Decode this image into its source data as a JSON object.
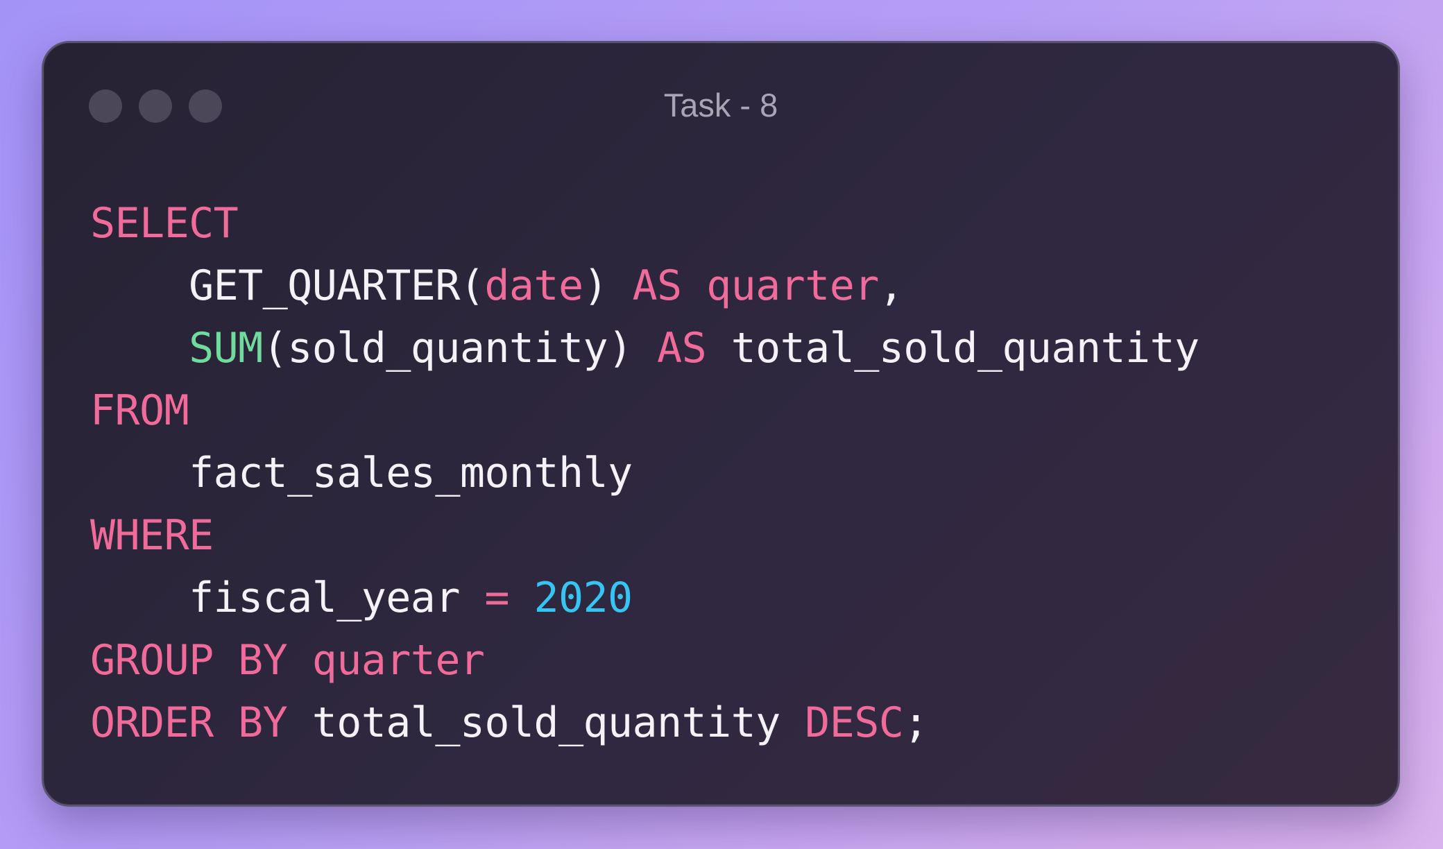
{
  "window": {
    "title": "Task - 8"
  },
  "code": {
    "lines": [
      [
        {
          "text": "SELECT",
          "kind": "keyword"
        }
      ],
      [
        {
          "text": "    GET_QUARTER(",
          "kind": "plain"
        },
        {
          "text": "date",
          "kind": "keyword"
        },
        {
          "text": ") ",
          "kind": "plain"
        },
        {
          "text": "AS",
          "kind": "keyword"
        },
        {
          "text": " ",
          "kind": "plain"
        },
        {
          "text": "quarter",
          "kind": "keyword"
        },
        {
          "text": ",",
          "kind": "plain"
        }
      ],
      [
        {
          "text": "    ",
          "kind": "plain"
        },
        {
          "text": "SUM",
          "kind": "function"
        },
        {
          "text": "(sold_quantity) ",
          "kind": "plain"
        },
        {
          "text": "AS",
          "kind": "keyword"
        },
        {
          "text": " total_sold_quantity",
          "kind": "plain"
        }
      ],
      [
        {
          "text": "FROM",
          "kind": "keyword"
        }
      ],
      [
        {
          "text": "    fact_sales_monthly",
          "kind": "plain"
        }
      ],
      [
        {
          "text": "WHERE",
          "kind": "keyword"
        }
      ],
      [
        {
          "text": "    fiscal_year ",
          "kind": "plain"
        },
        {
          "text": "=",
          "kind": "keyword"
        },
        {
          "text": " ",
          "kind": "plain"
        },
        {
          "text": "2020",
          "kind": "number"
        }
      ],
      [
        {
          "text": "GROUP BY",
          "kind": "keyword"
        },
        {
          "text": " ",
          "kind": "plain"
        },
        {
          "text": "quarter",
          "kind": "keyword"
        }
      ],
      [
        {
          "text": "ORDER BY",
          "kind": "keyword"
        },
        {
          "text": " total_sold_quantity ",
          "kind": "plain"
        },
        {
          "text": "DESC",
          "kind": "keyword"
        },
        {
          "text": ";",
          "kind": "plain"
        }
      ]
    ]
  },
  "colors": {
    "keyword": "#f06b9a",
    "function": "#6fdb9c",
    "number": "#36c4f2",
    "plain": "#f4f2f6"
  }
}
